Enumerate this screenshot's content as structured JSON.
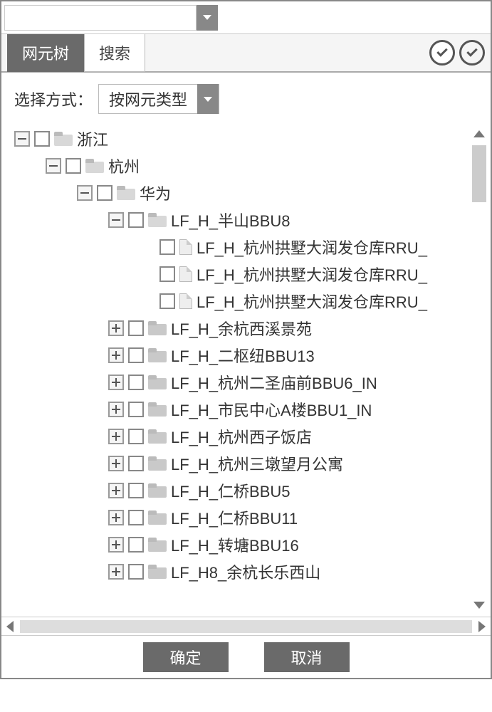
{
  "tabs": {
    "tree": "网元树",
    "search": "搜索"
  },
  "filter": {
    "label": "选择方式：",
    "value": "按网元类型"
  },
  "buttons": {
    "ok": "确定",
    "cancel": "取消"
  },
  "tree": {
    "root": {
      "label": "浙江",
      "expanded": true
    },
    "city": {
      "label": "杭州",
      "expanded": true
    },
    "vendor": {
      "label": "华为",
      "expanded": true
    },
    "bbu8": {
      "label": "LF_H_半山BBU8",
      "expanded": true
    },
    "rru": [
      "LF_H_杭州拱墅大润发仓库RRU_",
      "LF_H_杭州拱墅大润发仓库RRU_",
      "LF_H_杭州拱墅大润发仓库RRU_"
    ],
    "siblings": [
      "LF_H_余杭西溪景苑",
      "LF_H_二枢纽BBU13",
      "LF_H_杭州二圣庙前BBU6_IN",
      "LF_H_市民中心A楼BBU1_IN",
      "LF_H_杭州西子饭店",
      "LF_H_杭州三墩望月公寓",
      "LF_H_仁桥BBU5",
      "LF_H_仁桥BBU11",
      "LF_H_转塘BBU16",
      "LF_H8_余杭长乐西山"
    ]
  }
}
